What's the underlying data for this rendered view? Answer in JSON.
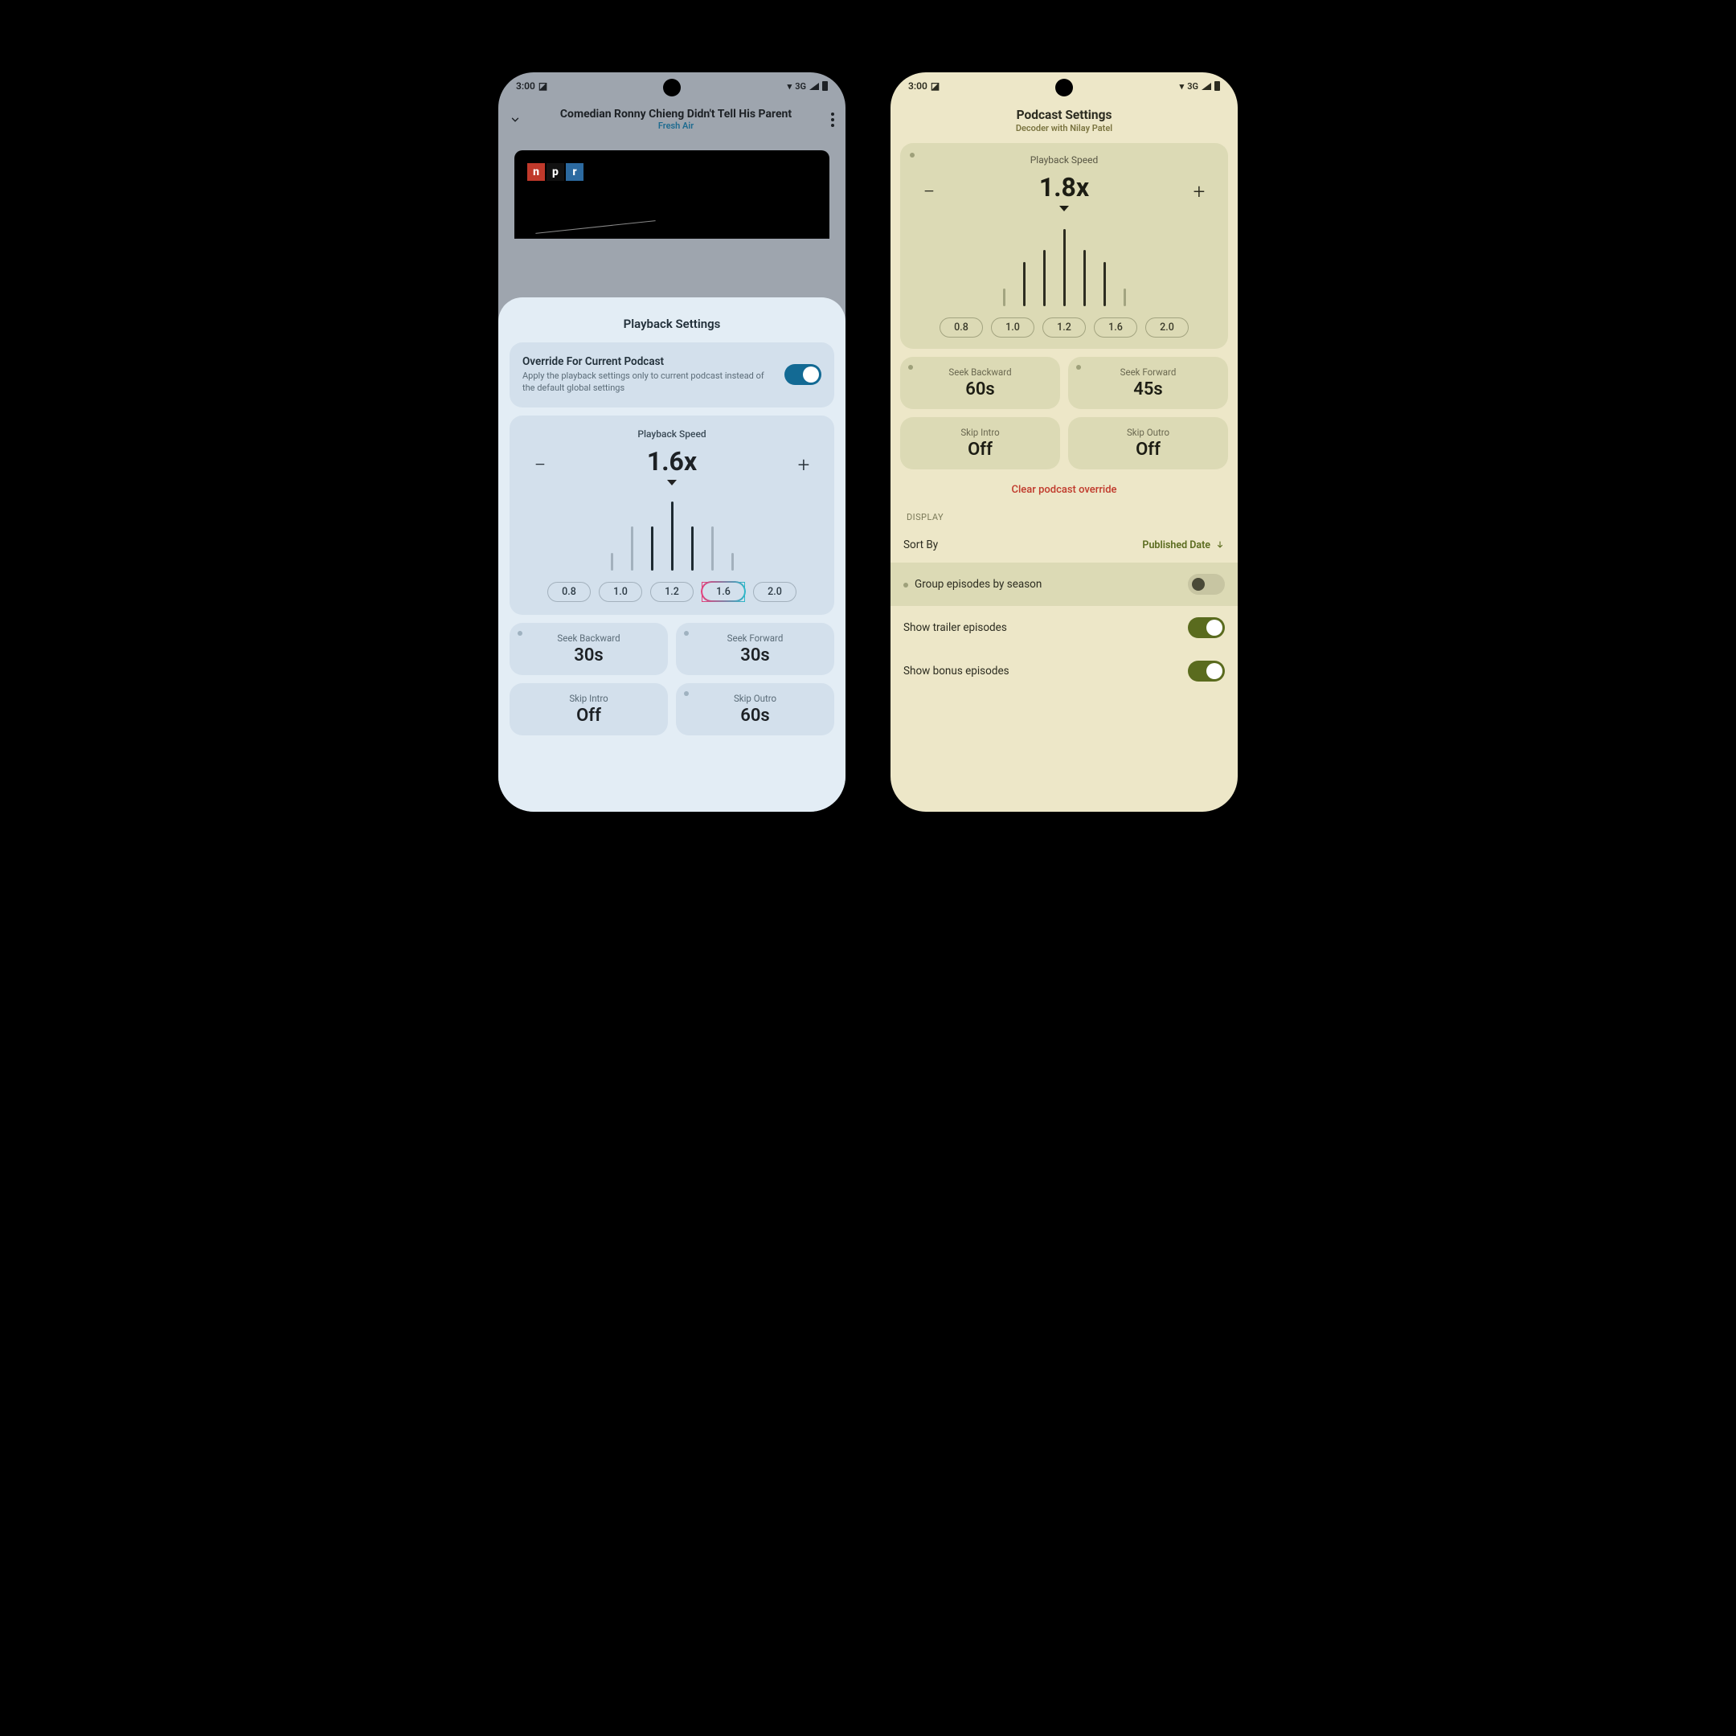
{
  "status": {
    "time": "3:00",
    "net": "3G"
  },
  "phoneA": {
    "nowPlaying": {
      "title": "Comedian Ronny Chieng Didn't Tell His Parent",
      "show": "Fresh Air"
    },
    "sheetTitle": "Playback Settings",
    "override": {
      "title": "Override For Current Podcast",
      "desc": "Apply the playback settings only to current podcast instead of the default global settings",
      "on": true
    },
    "speed": {
      "label": "Playback Speed",
      "value": "1.6x",
      "presets": [
        "0.8",
        "1.0",
        "1.2",
        "1.6",
        "2.0"
      ],
      "active": "1.6"
    },
    "seekBack": {
      "label": "Seek Backward",
      "value": "30s"
    },
    "seekFwd": {
      "label": "Seek Forward",
      "value": "30s"
    },
    "skipIntro": {
      "label": "Skip Intro",
      "value": "Off"
    },
    "skipOutro": {
      "label": "Skip Outro",
      "value": "60s"
    }
  },
  "phoneB": {
    "pageTitle": "Podcast Settings",
    "subtitle": "Decoder with Nilay Patel",
    "speed": {
      "label": "Playback Speed",
      "value": "1.8x",
      "presets": [
        "0.8",
        "1.0",
        "1.2",
        "1.6",
        "2.0"
      ]
    },
    "seekBack": {
      "label": "Seek Backward",
      "value": "60s"
    },
    "seekFwd": {
      "label": "Seek Forward",
      "value": "45s"
    },
    "skipIntro": {
      "label": "Skip Intro",
      "value": "Off"
    },
    "skipOutro": {
      "label": "Skip Outro",
      "value": "Off"
    },
    "clear": "Clear podcast override",
    "displayHeader": "DISPLAY",
    "sort": {
      "label": "Sort By",
      "value": "Published Date"
    },
    "groupBySeason": {
      "label": "Group episodes by season",
      "on": false
    },
    "showTrailers": {
      "label": "Show trailer episodes",
      "on": true
    },
    "showBonus": {
      "label": "Show bonus episodes",
      "on": true
    }
  }
}
